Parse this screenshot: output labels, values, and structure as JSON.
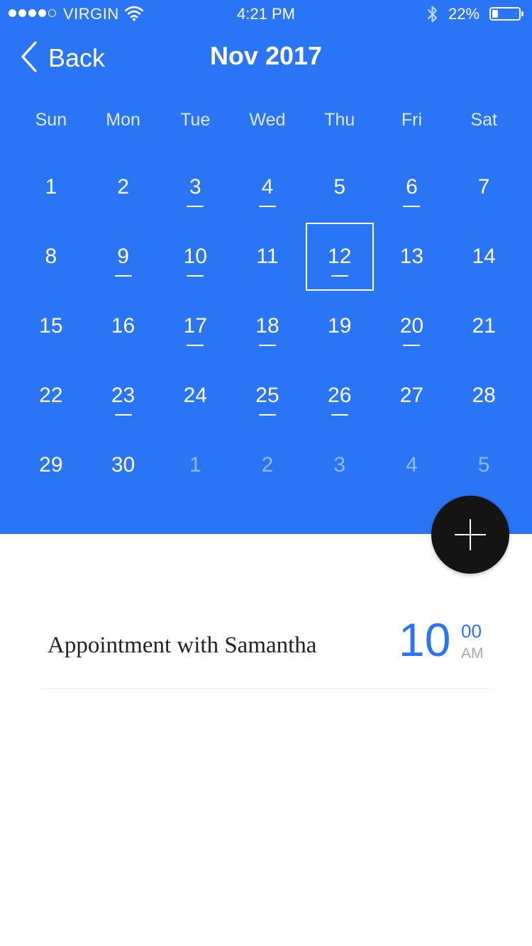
{
  "status_bar": {
    "signal_bars": 4,
    "signal_total": 5,
    "carrier": "VIRGIN",
    "time": "4:21 PM",
    "battery_percent": "22%",
    "battery_level": 0.22
  },
  "nav": {
    "back_label": "Back",
    "title": "Nov 2017"
  },
  "calendar": {
    "weekdays": [
      "Sun",
      "Mon",
      "Tue",
      "Wed",
      "Thu",
      "Fri",
      "Sat"
    ],
    "selected_day": 12,
    "days": [
      {
        "day": "1",
        "current": true,
        "marked": false
      },
      {
        "day": "2",
        "current": true,
        "marked": false
      },
      {
        "day": "3",
        "current": true,
        "marked": true
      },
      {
        "day": "4",
        "current": true,
        "marked": true
      },
      {
        "day": "5",
        "current": true,
        "marked": false
      },
      {
        "day": "6",
        "current": true,
        "marked": true
      },
      {
        "day": "7",
        "current": true,
        "marked": false
      },
      {
        "day": "8",
        "current": true,
        "marked": false
      },
      {
        "day": "9",
        "current": true,
        "marked": true
      },
      {
        "day": "10",
        "current": true,
        "marked": true
      },
      {
        "day": "11",
        "current": true,
        "marked": false
      },
      {
        "day": "12",
        "current": true,
        "marked": true
      },
      {
        "day": "13",
        "current": true,
        "marked": false
      },
      {
        "day": "14",
        "current": true,
        "marked": false
      },
      {
        "day": "15",
        "current": true,
        "marked": false
      },
      {
        "day": "16",
        "current": true,
        "marked": false
      },
      {
        "day": "17",
        "current": true,
        "marked": true
      },
      {
        "day": "18",
        "current": true,
        "marked": true
      },
      {
        "day": "19",
        "current": true,
        "marked": false
      },
      {
        "day": "20",
        "current": true,
        "marked": true
      },
      {
        "day": "21",
        "current": true,
        "marked": false
      },
      {
        "day": "22",
        "current": true,
        "marked": false
      },
      {
        "day": "23",
        "current": true,
        "marked": true
      },
      {
        "day": "24",
        "current": true,
        "marked": false
      },
      {
        "day": "25",
        "current": true,
        "marked": true
      },
      {
        "day": "26",
        "current": true,
        "marked": true
      },
      {
        "day": "27",
        "current": true,
        "marked": false
      },
      {
        "day": "28",
        "current": true,
        "marked": false
      },
      {
        "day": "29",
        "current": true,
        "marked": false
      },
      {
        "day": "30",
        "current": true,
        "marked": false
      },
      {
        "day": "1",
        "current": false,
        "marked": false
      },
      {
        "day": "2",
        "current": false,
        "marked": false
      },
      {
        "day": "3",
        "current": false,
        "marked": false
      },
      {
        "day": "4",
        "current": false,
        "marked": false
      },
      {
        "day": "5",
        "current": false,
        "marked": false
      }
    ]
  },
  "fab": {
    "icon": "plus-icon"
  },
  "events": [
    {
      "title": "Appointment with Samantha",
      "hour": "10",
      "minute": "00",
      "ampm": "AM"
    }
  ],
  "colors": {
    "accent": "#2a74f6",
    "fab": "#141414",
    "event_title": "#222222",
    "ampm": "#a8a8a8"
  }
}
